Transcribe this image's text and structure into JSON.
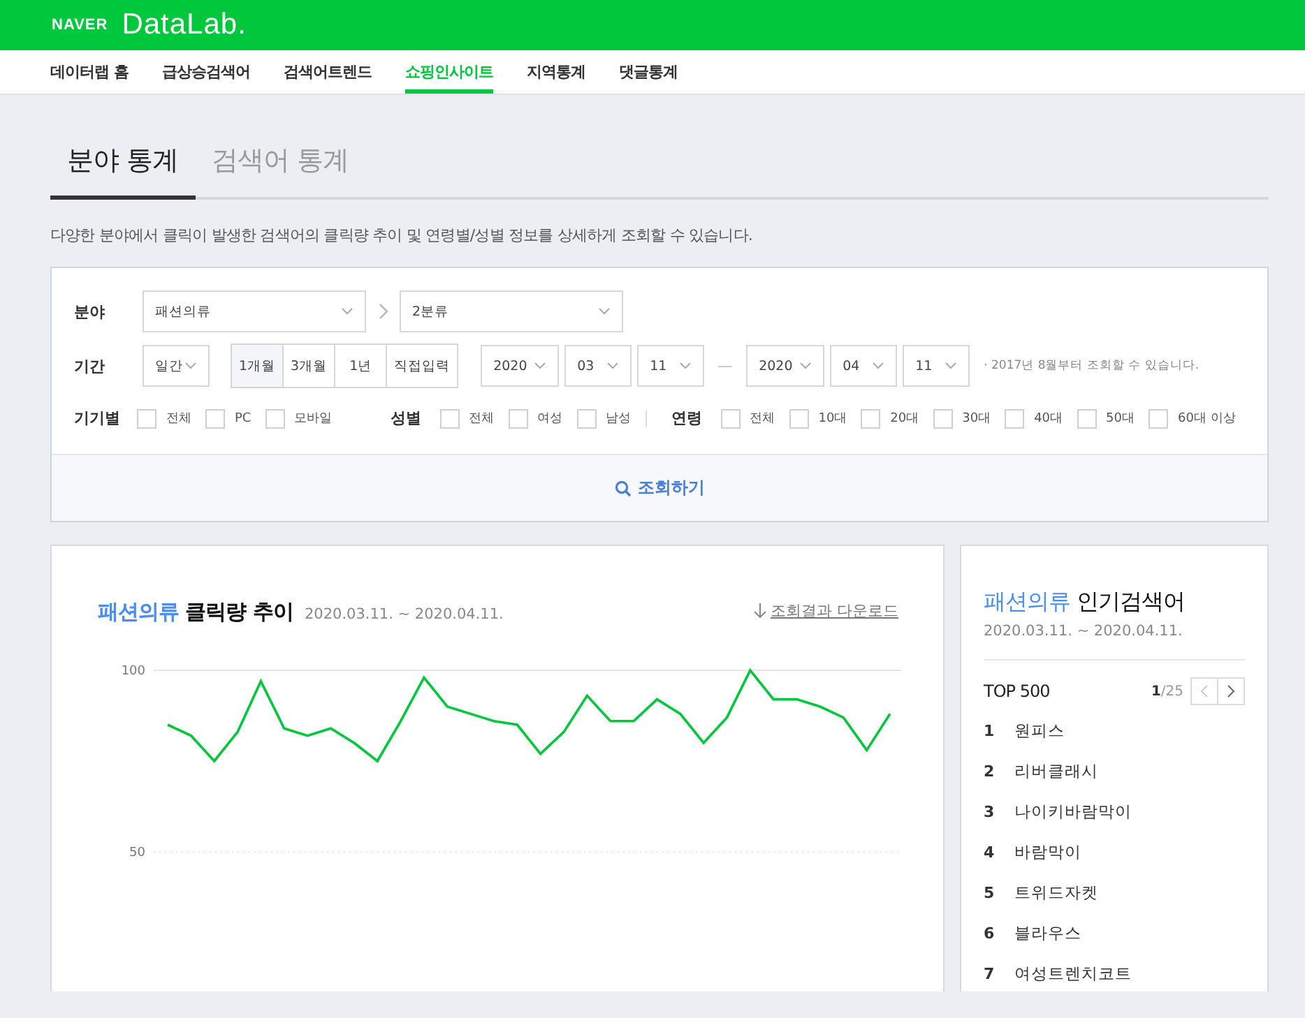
{
  "header": {
    "brand": "NAVER",
    "product": "DataLab."
  },
  "nav": [
    {
      "label": "데이터랩 홈",
      "selected": false
    },
    {
      "label": "급상승검색어",
      "selected": false
    },
    {
      "label": "검색어트렌드",
      "selected": false
    },
    {
      "label": "쇼핑인사이트",
      "selected": true
    },
    {
      "label": "지역통계",
      "selected": false
    },
    {
      "label": "댓글통계",
      "selected": false
    }
  ],
  "tabs": [
    {
      "label": "분야 통계",
      "selected": true
    },
    {
      "label": "검색어 통계",
      "selected": false
    }
  ],
  "description": "다양한 분야에서 클릭이 발생한 검색어의 클릭량 추이 및 연령별/성별 정보를 상세하게 조회할 수 있습니다.",
  "filters": {
    "category": {
      "label": "분야",
      "first": "패션의류",
      "second": "2분류"
    },
    "period": {
      "label": "기간",
      "unit": "일간",
      "ranges": [
        {
          "label": "1개월",
          "selected": true
        },
        {
          "label": "3개월",
          "selected": false
        },
        {
          "label": "1년",
          "selected": false
        },
        {
          "label": "직접입력",
          "selected": false
        }
      ],
      "start": [
        "2020",
        "03",
        "11"
      ],
      "end": [
        "2020",
        "04",
        "11"
      ],
      "note": "· 2017년 8월부터 조회할 수 있습니다."
    },
    "groups": [
      {
        "label": "기기별",
        "options": [
          {
            "label": "전체",
            "checked": false
          },
          {
            "label": "PC",
            "checked": false
          },
          {
            "label": "모바일",
            "checked": false
          }
        ]
      },
      {
        "label": "성별",
        "options": [
          {
            "label": "전체",
            "checked": false
          },
          {
            "label": "여성",
            "checked": false
          },
          {
            "label": "남성",
            "checked": false
          }
        ]
      },
      {
        "label": "연령",
        "options": [
          {
            "label": "전체",
            "checked": false
          },
          {
            "label": "10대",
            "checked": false
          },
          {
            "label": "20대",
            "checked": false
          },
          {
            "label": "30대",
            "checked": false
          },
          {
            "label": "40대",
            "checked": false
          },
          {
            "label": "50대",
            "checked": false
          },
          {
            "label": "60대 이상",
            "checked": false
          }
        ]
      }
    ],
    "submit": "조회하기"
  },
  "trend": {
    "category": "패션의류",
    "title": "클릭량 추이",
    "dates": "2020.03.11. ~ 2020.04.11.",
    "download": "조회결과 다운로드",
    "chart_data": {
      "type": "line",
      "ylim": [
        50,
        100
      ],
      "yticks": [
        50,
        100
      ],
      "series": [
        {
          "color": "#00c73c",
          "values": [
            85,
            82,
            75,
            83,
            97,
            84,
            82,
            84,
            80,
            75,
            86,
            98,
            90,
            88,
            86,
            85,
            77,
            83,
            93,
            86,
            86,
            92,
            88,
            80,
            87,
            100,
            92,
            92,
            90,
            87,
            78,
            88
          ]
        }
      ]
    }
  },
  "ranking": {
    "category": "패션의류",
    "title": "인기검색어",
    "dates": "2020.03.11. ~ 2020.04.11.",
    "heading": "TOP 500",
    "page": "1",
    "pages": "/25",
    "items": [
      {
        "rank": "1",
        "term": "원피스"
      },
      {
        "rank": "2",
        "term": "리버클래시"
      },
      {
        "rank": "3",
        "term": "나이키바람막이"
      },
      {
        "rank": "4",
        "term": "바람막이"
      },
      {
        "rank": "5",
        "term": "트위드자켓"
      },
      {
        "rank": "6",
        "term": "블라우스"
      },
      {
        "rank": "7",
        "term": "여성트렌치코트"
      }
    ]
  }
}
